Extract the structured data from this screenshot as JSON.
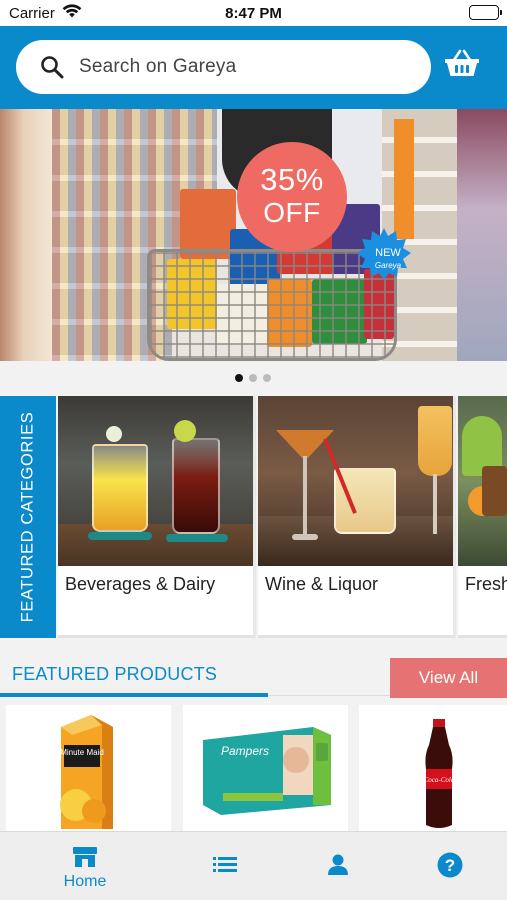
{
  "status_bar": {
    "carrier": "Carrier",
    "time": "8:47 PM"
  },
  "search": {
    "placeholder": "Search on Gareya"
  },
  "banner": {
    "discount_percent": "35%",
    "discount_off": "OFF",
    "new_badge": "NEW",
    "new_badge_brand": "Gareya",
    "pagination": {
      "pages": 3,
      "active": 1
    }
  },
  "featured_categories": {
    "title": "FEATURED CATEGORIES",
    "items": [
      {
        "label": "Beverages & Dairy"
      },
      {
        "label": "Wine & Liquor"
      },
      {
        "label": "Fresh"
      }
    ]
  },
  "featured_products": {
    "title": "FEATURED PRODUCTS",
    "view_all": "View All",
    "items": [
      {
        "brand_text": "Minute Maid",
        "image": "orange-juice-carton"
      },
      {
        "brand_text": "Pampers",
        "image": "diaper-box"
      },
      {
        "brand_text": "Coca-Cola",
        "image": "soda-bottle"
      }
    ]
  },
  "tab_bar": {
    "items": [
      {
        "icon": "store-icon",
        "label": "Home",
        "active": true
      },
      {
        "icon": "list-icon",
        "label": "",
        "active": false
      },
      {
        "icon": "user-icon",
        "label": "",
        "active": false
      },
      {
        "icon": "help-icon",
        "label": "",
        "active": false
      }
    ]
  },
  "colors": {
    "primary": "#0b8acb",
    "accent": "#e57373",
    "badge": "#ee6a63"
  }
}
